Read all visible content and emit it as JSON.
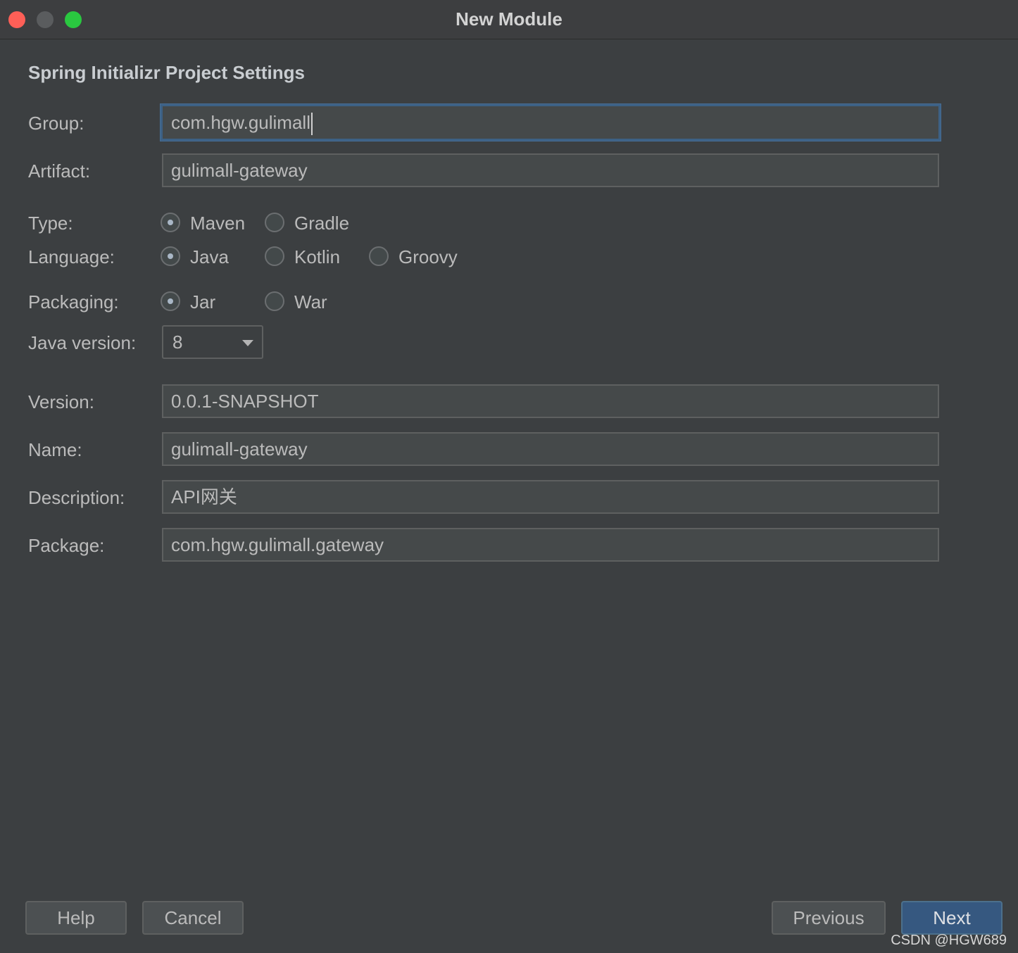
{
  "window": {
    "title": "New Module"
  },
  "section": {
    "title": "Spring Initializr Project Settings"
  },
  "fields": {
    "group": {
      "label": "Group:",
      "value": "com.hgw.gulimall"
    },
    "artifact": {
      "label": "Artifact:",
      "value": "gulimall-gateway"
    },
    "version": {
      "label": "Version:",
      "value": "0.0.1-SNAPSHOT"
    },
    "name": {
      "label": "Name:",
      "value": "gulimall-gateway"
    },
    "description": {
      "label": "Description:",
      "value": "API网关"
    },
    "package": {
      "label": "Package:",
      "value": "com.hgw.gulimall.gateway"
    }
  },
  "type": {
    "label": "Type:",
    "options": [
      "Maven",
      "Gradle"
    ],
    "selected": "Maven"
  },
  "language": {
    "label": "Language:",
    "options": [
      "Java",
      "Kotlin",
      "Groovy"
    ],
    "selected": "Java"
  },
  "packaging": {
    "label": "Packaging:",
    "options": [
      "Jar",
      "War"
    ],
    "selected": "Jar"
  },
  "java_version": {
    "label": "Java version:",
    "value": "8"
  },
  "buttons": {
    "help": "Help",
    "cancel": "Cancel",
    "previous": "Previous",
    "next": "Next"
  },
  "watermark": "CSDN @HGW689",
  "colors": {
    "background": "#3c3f41",
    "primary_button": "#365880",
    "focus_border": "#3d6185",
    "close": "#fe5f57",
    "maximize": "#2ac840"
  }
}
